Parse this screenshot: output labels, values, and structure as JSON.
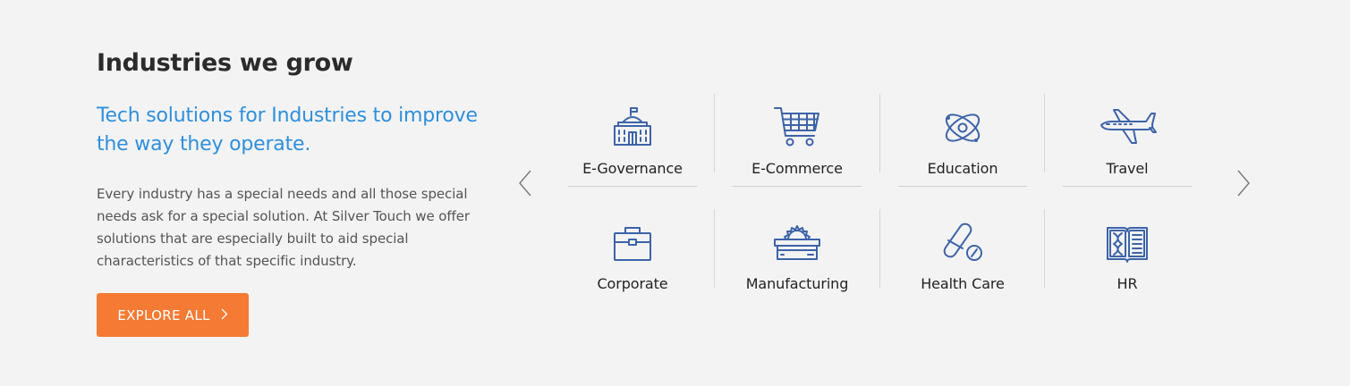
{
  "section": {
    "title": "Industries we grow",
    "subtitle": "Tech solutions for Industries to improve the way they operate.",
    "description": "Every industry has a special needs and all those special needs ask for a special solution. At Silver Touch we offer solutions that are especially built to aid special characteristics of that specific industry.",
    "cta_label": "EXPLORE ALL",
    "cta_icon": "chevron-right-icon"
  },
  "colors": {
    "background": "#f3f3f3",
    "accent_blue": "#2f8fdc",
    "icon_blue": "#3d63a8",
    "button_orange": "#f57a33"
  },
  "carousel": {
    "prev_icon": "chevron-left-icon",
    "next_icon": "chevron-right-icon",
    "industries": [
      {
        "label": "E-Governance",
        "icon": "government-building-icon"
      },
      {
        "label": "E-Commerce",
        "icon": "shopping-cart-icon"
      },
      {
        "label": "Education",
        "icon": "atom-icon"
      },
      {
        "label": "Travel",
        "icon": "airplane-icon"
      },
      {
        "label": "Corporate",
        "icon": "briefcase-icon"
      },
      {
        "label": "Manufacturing",
        "icon": "saw-machine-icon"
      },
      {
        "label": "Health Care",
        "icon": "pills-icon"
      },
      {
        "label": "HR",
        "icon": "dna-book-icon"
      }
    ]
  }
}
